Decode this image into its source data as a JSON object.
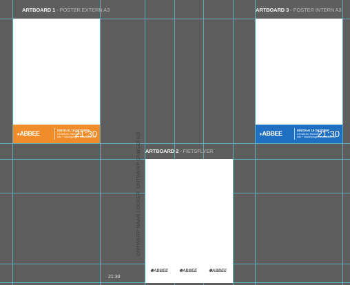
{
  "artboards": {
    "ab1": {
      "number": "ARTBOARD 1",
      "sep": " - ",
      "name": "POSTER EXTERN A3"
    },
    "ab2": {
      "number": "ARTBOARD 2",
      "sep": " - ",
      "name": "FIETSFLYER"
    },
    "ab3": {
      "number": "ARTBOARD 3",
      "sep": " - ",
      "name": "POSTER INTERN A3"
    }
  },
  "poster": {
    "logo": "ABBEE",
    "date": "DINSDAG 19 OKTOBER",
    "line1": "ATOMIUM, PAVIOEN",
    "line2": "Info + inschrijvingen www.abbee.be",
    "time": "21:30"
  },
  "flyer": {
    "vtext_top": "ONTWERP ONBEKEND",
    "vtext_bottom": "ONTWERP NAAR LOCKER",
    "mini_logo": "ABBEE"
  },
  "canvas": {
    "loose_time": "21:30"
  },
  "colors": {
    "canvas": "#5e5e5e",
    "guide": "#5fc6d8",
    "orange": "#f08c2a",
    "blue": "#1f6fc2"
  }
}
